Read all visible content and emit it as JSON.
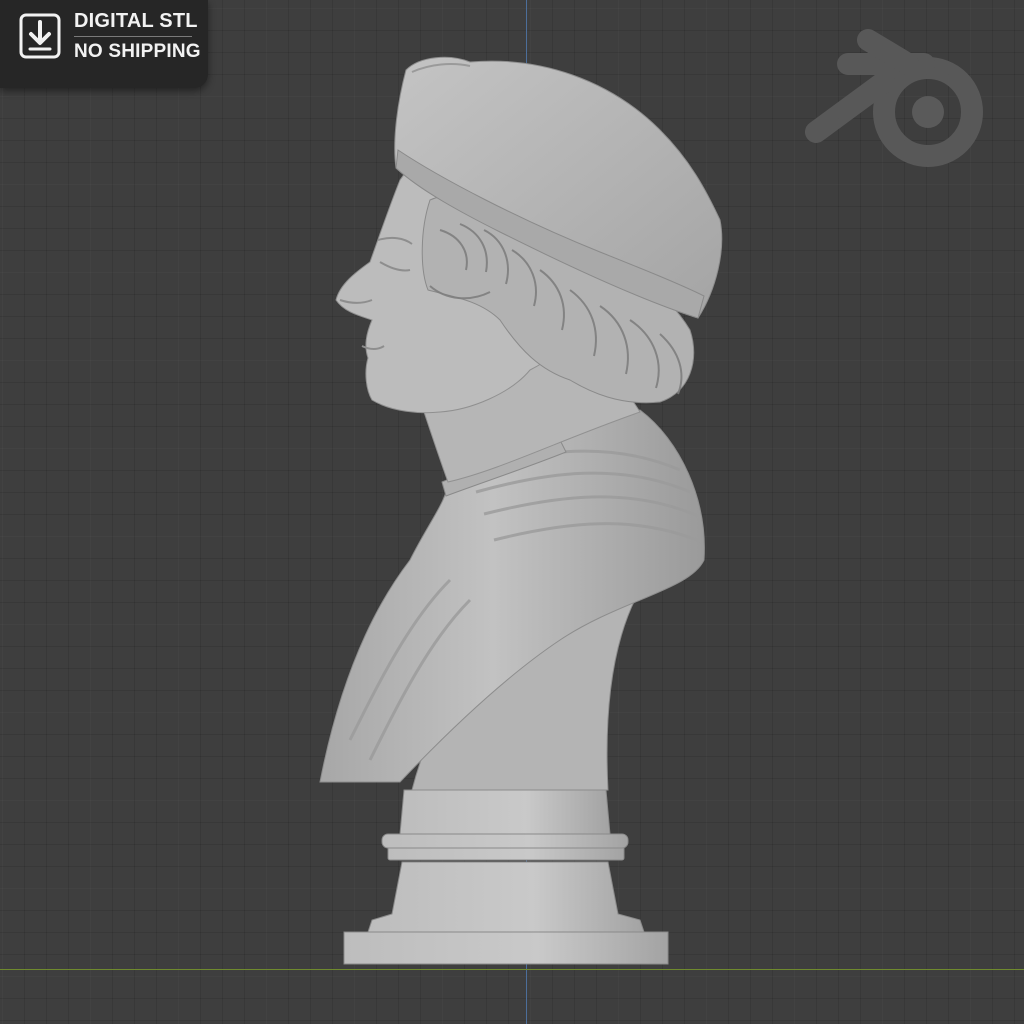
{
  "badge": {
    "line1": "DIGITAL STL",
    "line2": "NO SHIPPING",
    "icon": "download-icon"
  },
  "watermark": {
    "icon": "blender-logo-icon"
  },
  "viewport": {
    "background": "#3e3e3e",
    "axis_x_color": "#6f8a2e",
    "axis_y_color": "#4c6e9a",
    "model_color": "#b9b9b9"
  }
}
